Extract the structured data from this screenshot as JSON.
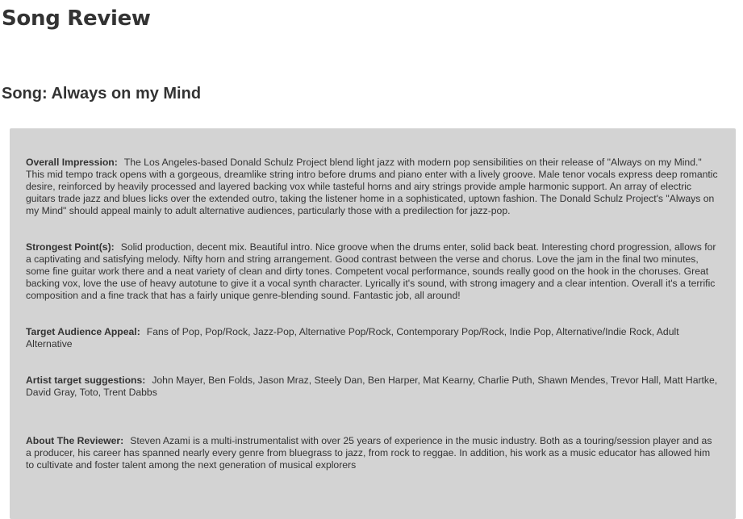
{
  "page": {
    "title": "Song Review",
    "song_title": "Song: Always on my Mind"
  },
  "review": {
    "overall_impression": {
      "label": "Overall Impression:",
      "text": "The Los Angeles-based Donald Schulz Project blend light jazz with modern pop sensibilities on their release of \"Always on my Mind.\" This mid tempo track opens with a gorgeous, dreamlike string intro before drums and piano enter with a lively groove. Male tenor vocals express deep romantic desire, reinforced by heavily processed and layered backing vox while tasteful horns and airy strings provide ample harmonic support. An array of electric guitars trade jazz and blues licks over the extended outro, taking the listener home in a sophisticated, uptown fashion. The Donald Schulz Project's \"Always on my Mind\" should appeal mainly to adult alternative audiences, particularly those with a predilection for jazz-pop."
    },
    "strongest_points": {
      "label": "Strongest Point(s):",
      "text": "Solid production, decent mix. Beautiful intro. Nice groove when the drums enter, solid back beat. Interesting chord progression, allows for a captivating and satisfying melody. Nifty horn and string arrangement. Good contrast between the verse and chorus. Love the jam in the final two minutes, some fine guitar work there and a neat variety of clean and dirty tones. Competent vocal performance, sounds really good on the hook in the choruses. Great backing vox, love the use of heavy autotune to give it a vocal synth character. Lyrically it's sound, with strong imagery and a clear intention. Overall it's a terrific composition and a fine track that has a fairly unique genre-blending sound. Fantastic job, all around!"
    },
    "target_audience": {
      "label": "Target Audience Appeal:",
      "text": "Fans of Pop, Pop/Rock, Jazz-Pop, Alternative Pop/Rock, Contemporary Pop/Rock, Indie Pop, Alternative/Indie Rock, Adult Alternative"
    },
    "artist_suggestions": {
      "label": "Artist target suggestions:",
      "text": "John Mayer, Ben Folds, Jason Mraz, Steely Dan, Ben Harper, Mat Kearny, Charlie Puth, Shawn Mendes, Trevor Hall, Matt Hartke, David Gray, Toto, Trent Dabbs"
    },
    "about_reviewer": {
      "label": "About The Reviewer:",
      "text": "Steven Azami is a multi-instrumentalist with over 25 years of experience in the music industry. Both as a touring/session player and as a producer, his career has spanned nearly every genre from bluegrass to jazz, from rock to reggae. In addition, his work as a music educator has allowed him to cultivate and foster talent among the next generation of musical explorers"
    }
  },
  "colors": {
    "panel_background": "#d3d3d3",
    "text": "#333333",
    "page_background": "#ffffff"
  }
}
